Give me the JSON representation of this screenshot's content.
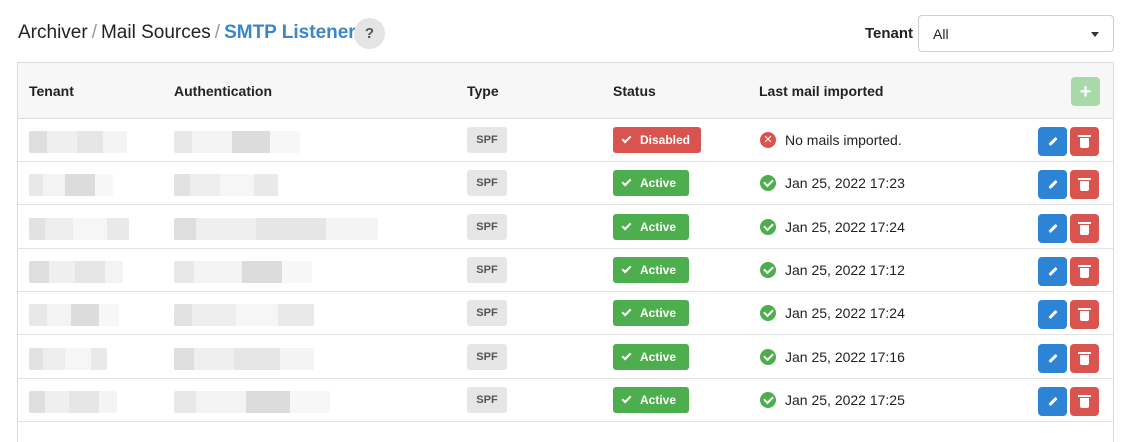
{
  "breadcrumb": {
    "items": [
      "Archiver",
      "Mail Sources"
    ],
    "separator": "/",
    "current": "SMTP Listeners"
  },
  "help": {
    "label": "?"
  },
  "tenant_filter": {
    "label": "Tenant",
    "value": "All"
  },
  "table": {
    "headers": {
      "tenant": "Tenant",
      "authentication": "Authentication",
      "type": "Type",
      "status": "Status",
      "last_mail": "Last mail imported"
    },
    "add_button": {
      "icon": "plus-icon",
      "glyph": "+"
    },
    "rows": [
      {
        "type": "SPF",
        "status": "Disabled",
        "status_kind": "disabled",
        "last_mail": "No mails imported.",
        "last_mail_kind": "error"
      },
      {
        "type": "SPF",
        "status": "Active",
        "status_kind": "active",
        "last_mail": "Jan 25, 2022 17:23",
        "last_mail_kind": "ok"
      },
      {
        "type": "SPF",
        "status": "Active",
        "status_kind": "active",
        "last_mail": "Jan 25, 2022 17:24",
        "last_mail_kind": "ok"
      },
      {
        "type": "SPF",
        "status": "Active",
        "status_kind": "active",
        "last_mail": "Jan 25, 2022 17:12",
        "last_mail_kind": "ok"
      },
      {
        "type": "SPF",
        "status": "Active",
        "status_kind": "active",
        "last_mail": "Jan 25, 2022 17:24",
        "last_mail_kind": "ok"
      },
      {
        "type": "SPF",
        "status": "Active",
        "status_kind": "active",
        "last_mail": "Jan 25, 2022 17:16",
        "last_mail_kind": "ok"
      },
      {
        "type": "SPF",
        "status": "Active",
        "status_kind": "active",
        "last_mail": "Jan 25, 2022 17:25",
        "last_mail_kind": "ok"
      }
    ]
  },
  "colors": {
    "accent": "#3a86c8",
    "active": "#4cae4c",
    "disabled": "#d9534f",
    "edit": "#2d84d4",
    "delete": "#d9534f"
  }
}
